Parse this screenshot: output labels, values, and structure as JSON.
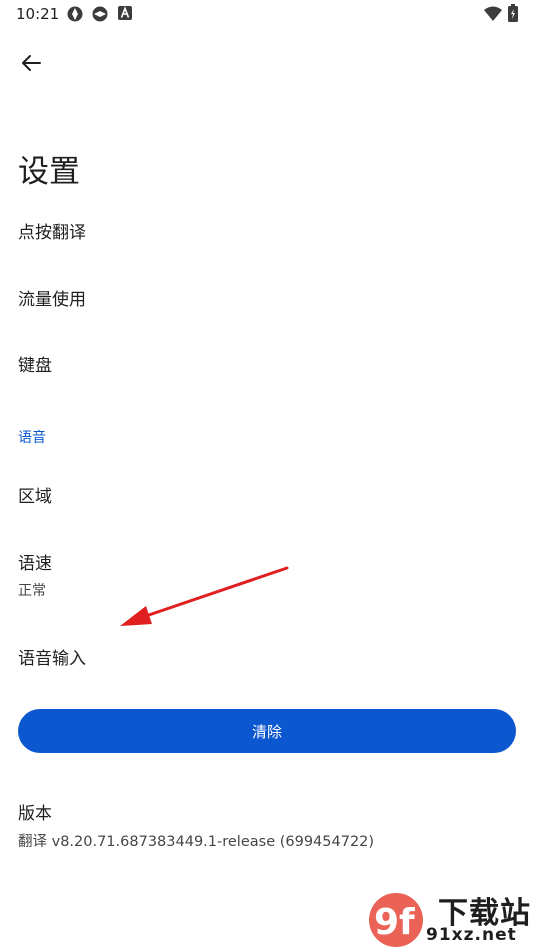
{
  "status_bar": {
    "time": "10:21",
    "icons": [
      "system-icon",
      "system-icon",
      "a-letter-icon",
      "wifi-icon",
      "battery-charging-icon"
    ]
  },
  "header": {
    "back_icon": "arrow-left-icon",
    "title": "设置"
  },
  "settings_items": [
    {
      "title": "点按翻译"
    },
    {
      "title": "流量使用"
    },
    {
      "title": "键盘"
    }
  ],
  "speech_section": {
    "header": "语音",
    "items": [
      {
        "title": "区域"
      },
      {
        "title": "语速",
        "subtitle": "正常"
      },
      {
        "title": "语音输入"
      }
    ]
  },
  "clear_button": {
    "label": "清除"
  },
  "version": {
    "title": "版本",
    "value": "翻译 v8.20.71.687383449.1-release (699454722)"
  },
  "watermark": {
    "logo_text": "9f",
    "text": "下载站",
    "url": "91xz.net"
  },
  "colors": {
    "accent": "#0b57d0",
    "annotation_arrow": "#e02020"
  }
}
